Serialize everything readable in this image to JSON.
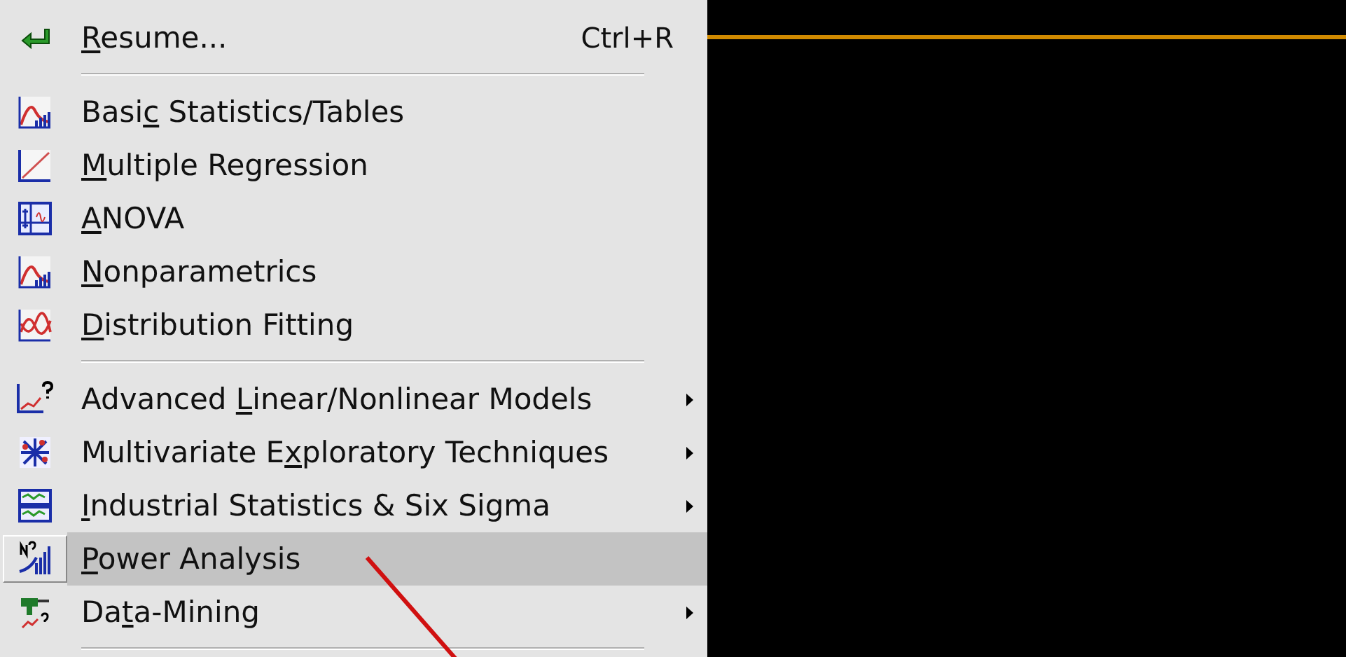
{
  "menu": {
    "items": [
      {
        "kind": "command",
        "key": "R",
        "after": "esume...",
        "shortcut": "Ctrl+R",
        "submenu": false,
        "selected": false
      },
      {
        "kind": "separator"
      },
      {
        "kind": "command",
        "before": "Basi",
        "key": "c",
        "after": " Statistics/Tables",
        "submenu": false,
        "selected": false
      },
      {
        "kind": "command",
        "key": "M",
        "after": "ultiple Regression",
        "submenu": false,
        "selected": false
      },
      {
        "kind": "command",
        "key": "A",
        "after": "NOVA",
        "submenu": false,
        "selected": false
      },
      {
        "kind": "command",
        "key": "N",
        "after": "onparametrics",
        "submenu": false,
        "selected": false
      },
      {
        "kind": "command",
        "key": "D",
        "after": "istribution Fitting",
        "submenu": false,
        "selected": false
      },
      {
        "kind": "separator"
      },
      {
        "kind": "command",
        "before": "Advanced ",
        "key": "L",
        "after": "inear/Nonlinear Models",
        "submenu": true,
        "selected": false
      },
      {
        "kind": "command",
        "before": "Multivariate E",
        "key": "x",
        "after": "ploratory Techniques",
        "submenu": true,
        "selected": false
      },
      {
        "kind": "command",
        "key": "I",
        "after": "ndustrial Statistics & Six Sigma",
        "submenu": true,
        "selected": false
      },
      {
        "kind": "command",
        "key": "P",
        "after": "ower Analysis",
        "submenu": false,
        "selected": true
      },
      {
        "kind": "command",
        "before": "Da",
        "key": "t",
        "after": "a-Mining",
        "submenu": true,
        "selected": false
      },
      {
        "kind": "separator"
      }
    ]
  }
}
